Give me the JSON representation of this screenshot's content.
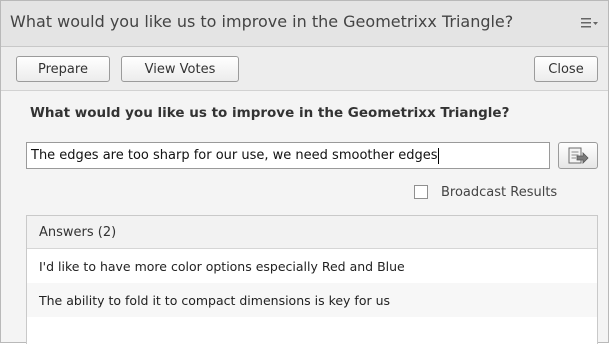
{
  "window": {
    "title": "What would you like us to improve in the Geometrixx Triangle?",
    "menu_icon": "list-menu-icon"
  },
  "toolbar": {
    "prepare_label": "Prepare",
    "view_votes_label": "View Votes",
    "close_label": "Close"
  },
  "question": {
    "text": "What would you like us to improve in the Geometrixx Triangle?"
  },
  "answer_input": {
    "value": "The edges are too sharp for our use, we need smoother edges",
    "submit_icon": "submit-answer-icon"
  },
  "broadcast": {
    "checked": false,
    "label": "Broadcast Results"
  },
  "answers": {
    "header": "Answers (2)",
    "items": [
      "I'd like to have more color options especially Red and Blue",
      "The ability to fold it to compact dimensions is key for us"
    ]
  }
}
